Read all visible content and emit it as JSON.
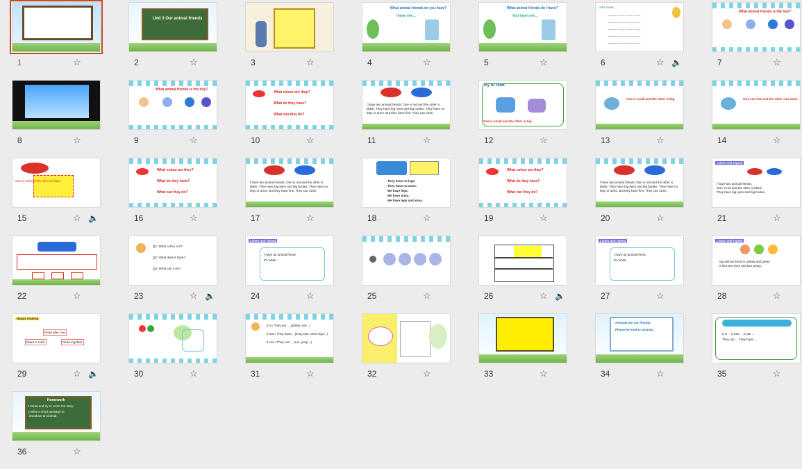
{
  "slides": [
    {
      "number": "1",
      "selected": true,
      "audio": false
    },
    {
      "number": "2",
      "selected": false,
      "audio": false,
      "board_text": "Unit 3 Our animal friends"
    },
    {
      "number": "3",
      "selected": false,
      "audio": false
    },
    {
      "number": "4",
      "selected": false,
      "audio": false,
      "title": "What animal friends do you have?",
      "subtitle": "I have one..."
    },
    {
      "number": "5",
      "selected": false,
      "audio": false,
      "title": "What animal friends do I have?",
      "subtitle": "You have one..."
    },
    {
      "number": "6",
      "selected": false,
      "audio": true
    },
    {
      "number": "7",
      "selected": false,
      "audio": false,
      "title": "What animal friends is the boy?"
    },
    {
      "number": "8",
      "selected": false,
      "audio": false
    },
    {
      "number": "9",
      "selected": false,
      "audio": false,
      "title": "What animal friends is the boy?"
    },
    {
      "number": "10",
      "selected": false,
      "audio": false,
      "title": "What colour are they?",
      "q2": "What do they have?",
      "q3": "What can they do?"
    },
    {
      "number": "11",
      "selected": false,
      "audio": false
    },
    {
      "number": "12",
      "selected": false,
      "audio": false,
      "title": "Try to read",
      "label": "One is small and the other is big."
    },
    {
      "number": "13",
      "selected": false,
      "audio": false,
      "label": "One is small and the other is big."
    },
    {
      "number": "14",
      "selected": false,
      "audio": false,
      "label": "One can ride and the other can swim."
    },
    {
      "number": "15",
      "selected": false,
      "audio": true
    },
    {
      "number": "16",
      "selected": false,
      "audio": false,
      "title": "What colour are they?",
      "q2": "What do they have?",
      "q3": "What can they do?"
    },
    {
      "number": "17",
      "selected": false,
      "audio": false
    },
    {
      "number": "18",
      "selected": false,
      "audio": false,
      "l1": "They have no legs.",
      "l2": "They have no arms.",
      "l3": "We have legs.",
      "l4": "We have arms.",
      "l5": "We have legs and arms."
    },
    {
      "number": "19",
      "selected": false,
      "audio": false,
      "title": "What colour are they?",
      "q2": "What do they have?",
      "q3": "What can they do?"
    },
    {
      "number": "20",
      "selected": false,
      "audio": false
    },
    {
      "number": "21",
      "selected": false,
      "audio": false,
      "title": "Listen and repeat"
    },
    {
      "number": "22",
      "selected": false,
      "audio": false
    },
    {
      "number": "23",
      "selected": false,
      "audio": true
    },
    {
      "number": "24",
      "selected": false,
      "audio": false,
      "title": "Listen and repeat"
    },
    {
      "number": "25",
      "selected": false,
      "audio": false
    },
    {
      "number": "26",
      "selected": false,
      "audio": true
    },
    {
      "number": "27",
      "selected": false,
      "audio": false,
      "title": "Listen and repeat"
    },
    {
      "number": "28",
      "selected": false,
      "audio": false,
      "title": "Listen and repeat"
    },
    {
      "number": "29",
      "selected": false,
      "audio": true,
      "title": "Happy reading",
      "b1": "Read after one",
      "b2": "Read in roles",
      "b3": "Read together"
    },
    {
      "number": "30",
      "selected": false,
      "audio": false
    },
    {
      "number": "31",
      "selected": false,
      "audio": false
    },
    {
      "number": "32",
      "selected": false,
      "audio": false
    },
    {
      "number": "33",
      "selected": false,
      "audio": false
    },
    {
      "number": "34",
      "selected": false,
      "audio": false,
      "l1": "Animals are our friends.",
      "l2": "Please be kind to animals."
    },
    {
      "number": "35",
      "selected": false,
      "audio": false
    },
    {
      "number": "36",
      "selected": false,
      "audio": false,
      "title": "Homework",
      "l1": "1.Read and try to recite the story.",
      "l2": "2.Write a short passage to",
      "l3": "introduce an animal."
    }
  ],
  "icons": {
    "star": "star-icon",
    "sound": "speaker-icon"
  },
  "accent": "#c1502e"
}
